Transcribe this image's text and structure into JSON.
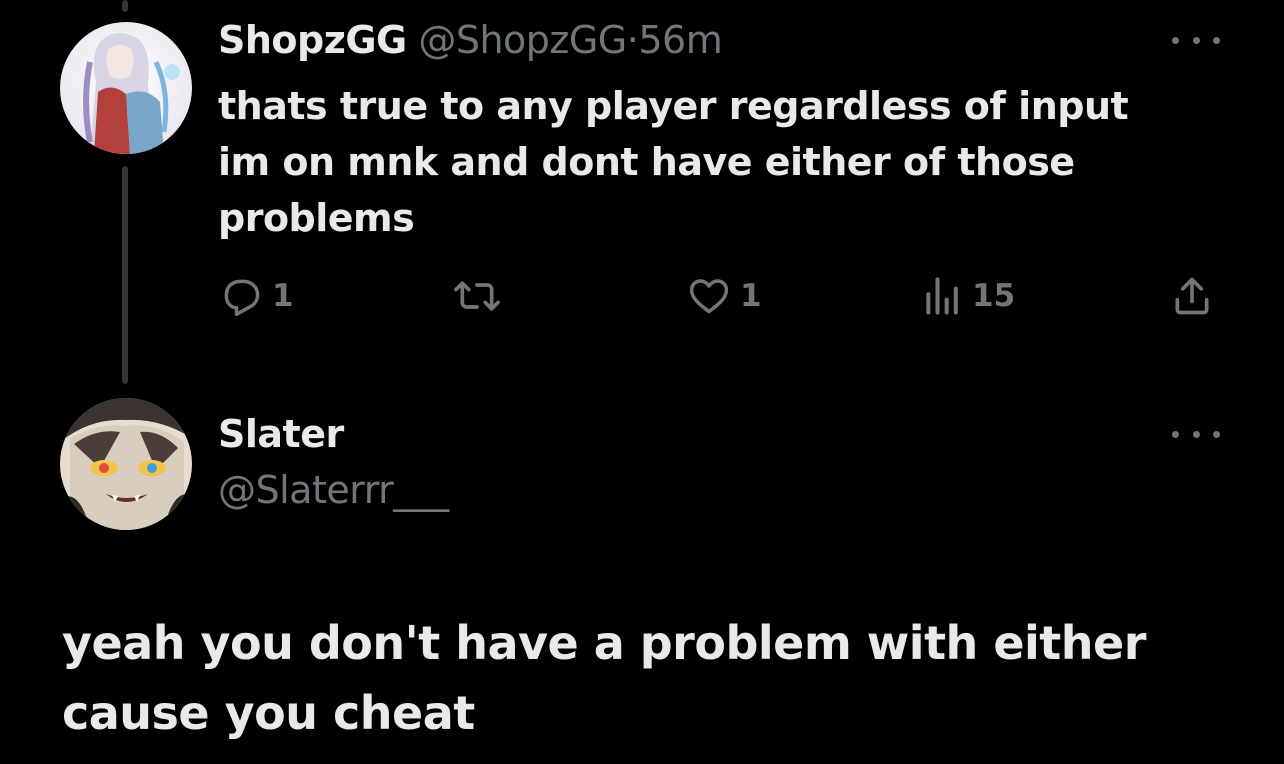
{
  "tweet": {
    "author_name": "ShopzGG",
    "author_handle": "@ShopzGG",
    "separator": "·",
    "time": "56m",
    "text_lines": [
      "thats true to any player regardless of input",
      "im on mnk and dont have either of those",
      "problems"
    ],
    "actions": {
      "reply_icon": "reply-icon",
      "reply_count": "1",
      "retweet_icon": "retweet-icon",
      "like_icon": "heart-icon",
      "like_count": "1",
      "views_icon": "analytics-icon",
      "views_count": "15",
      "share_icon": "share-icon"
    }
  },
  "reply": {
    "author_name": "Slater",
    "author_handle": "@Slaterrr___",
    "text_lines": [
      "yeah you don't have a problem with either",
      "cause you cheat"
    ]
  },
  "colors": {
    "background": "#000000",
    "text": "#e7e9ea",
    "muted": "#71767b",
    "thread_line": "#333639"
  }
}
